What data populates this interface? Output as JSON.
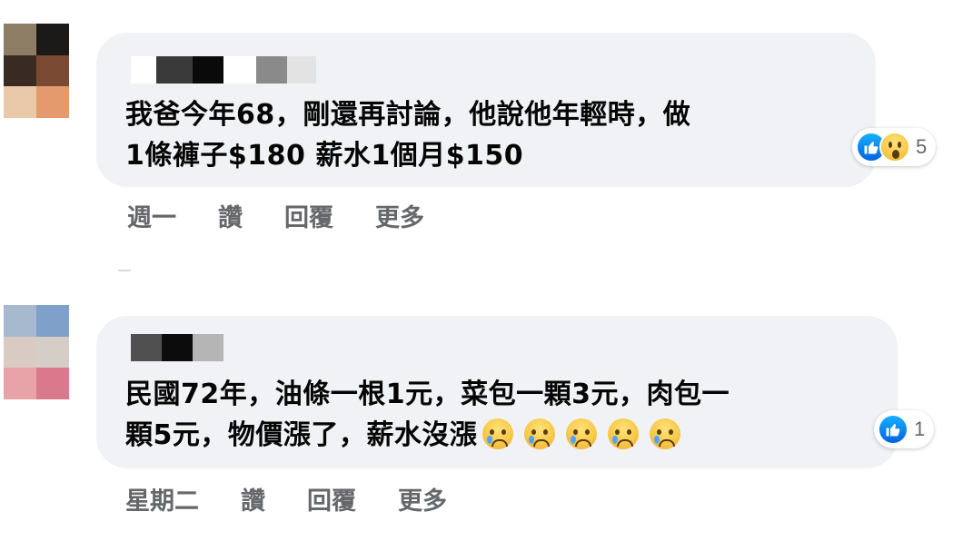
{
  "comments": [
    {
      "text_line1": "我爸今年68，剛還再討論，他說他年輕時，做",
      "text_line2": "1條褲子$180 薪水1個月$150",
      "reaction_count": "5",
      "reactions": [
        "like-icon",
        "wow-icon"
      ],
      "actions": {
        "time": "週一",
        "like": "讚",
        "reply": "回覆",
        "more": "更多"
      }
    },
    {
      "text_line1": "民國72年，油條一根1元，菜包一顆3元，肉包一",
      "text_line2": "顆5元，物價漲了，薪水沒漲",
      "emoji": [
        "crying-face-icon",
        "crying-face-icon",
        "crying-face-icon",
        "crying-face-icon",
        "crying-face-icon"
      ],
      "reaction_count": "1",
      "reactions": [
        "like-icon"
      ],
      "actions": {
        "time": "星期二",
        "like": "讚",
        "reply": "回覆",
        "more": "更多"
      }
    }
  ],
  "colors": {
    "bubble_bg": "#f0f2f5",
    "meta_text": "#65676b",
    "like_blue": "#1877f2"
  }
}
